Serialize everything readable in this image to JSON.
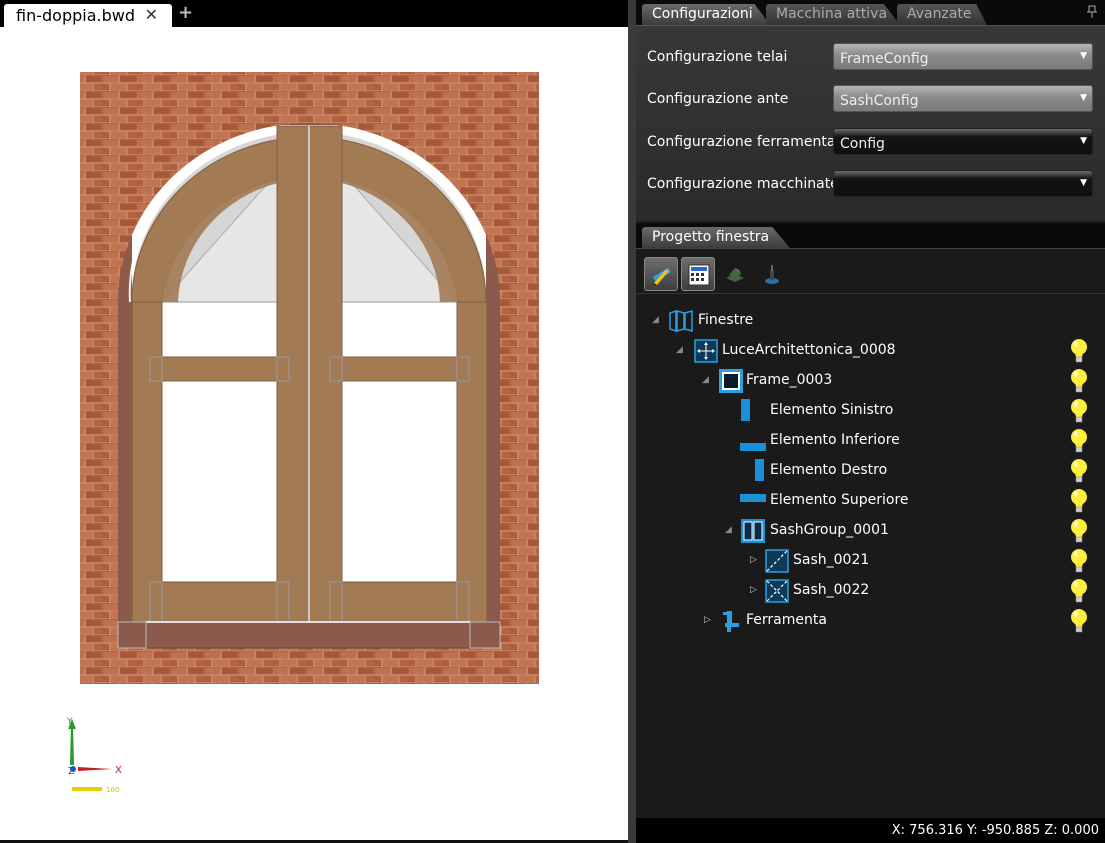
{
  "document_tab": {
    "title": "fin-doppia.bwd",
    "close_glyph": "✕",
    "add_glyph": "+"
  },
  "viewport": {
    "axis_y": "Y",
    "axis_x": "X",
    "axis_z": "Z",
    "scale_label": "100"
  },
  "config_tabs": [
    {
      "label": "Configurazioni",
      "active": true
    },
    {
      "label": "Macchina attiva",
      "active": false
    },
    {
      "label": "Avanzate",
      "active": false
    }
  ],
  "config_rows": [
    {
      "label": "Configurazione telai",
      "value": "FrameConfig"
    },
    {
      "label": "Configurazione ante",
      "value": "SashConfig"
    },
    {
      "label": "Configurazione ferramenta",
      "value": "Config"
    },
    {
      "label": "Configurazione macchinate",
      "value": ""
    }
  ],
  "project_tab": {
    "label": "Progetto finestra"
  },
  "toolbar": [
    "pencil-ruler-icon",
    "calculator-icon",
    "machine-icon",
    "tool-icon"
  ],
  "tree": [
    {
      "label": "Finestre",
      "icon": "window-panels-icon",
      "level": 0,
      "expander": "expanded",
      "bulb": false
    },
    {
      "label": "LuceArchitettonica_0008",
      "icon": "opening-icon",
      "level": 1,
      "expander": "expanded",
      "bulb": true
    },
    {
      "label": "Frame_0003",
      "icon": "frame-icon",
      "level": 2,
      "expander": "expanded",
      "bulb": true
    },
    {
      "label": "Elemento Sinistro",
      "icon": "left-element-icon",
      "level": 3,
      "expander": "none",
      "bulb": true
    },
    {
      "label": "Elemento Inferiore",
      "icon": "bottom-element-icon",
      "level": 3,
      "expander": "none",
      "bulb": true
    },
    {
      "label": "Elemento Destro",
      "icon": "right-element-icon",
      "level": 3,
      "expander": "none",
      "bulb": true
    },
    {
      "label": "Elemento Superiore",
      "icon": "top-element-icon",
      "level": 3,
      "expander": "none",
      "bulb": true
    },
    {
      "label": "SashGroup_0001",
      "icon": "sashgroup-icon",
      "level": 3,
      "expander": "expanded",
      "bulb": true
    },
    {
      "label": "Sash_0021",
      "icon": "sash-icon",
      "level": 4,
      "expander": "collapsed",
      "bulb": true
    },
    {
      "label": "Sash_0022",
      "icon": "sash-icon",
      "level": 4,
      "expander": "collapsed",
      "bulb": true
    },
    {
      "label": "Ferramenta",
      "icon": "hardware-icon",
      "level": 2,
      "expander": "collapsed",
      "bulb": true
    }
  ],
  "status": {
    "coords": "X: 756.316  Y: -950.885  Z: 0.000"
  },
  "colors": {
    "brick": "#b5603e",
    "wood": "#a07850",
    "frame": "#8a5a4a",
    "accent": "#2aa0e0",
    "bulb": "#ffef3a"
  }
}
